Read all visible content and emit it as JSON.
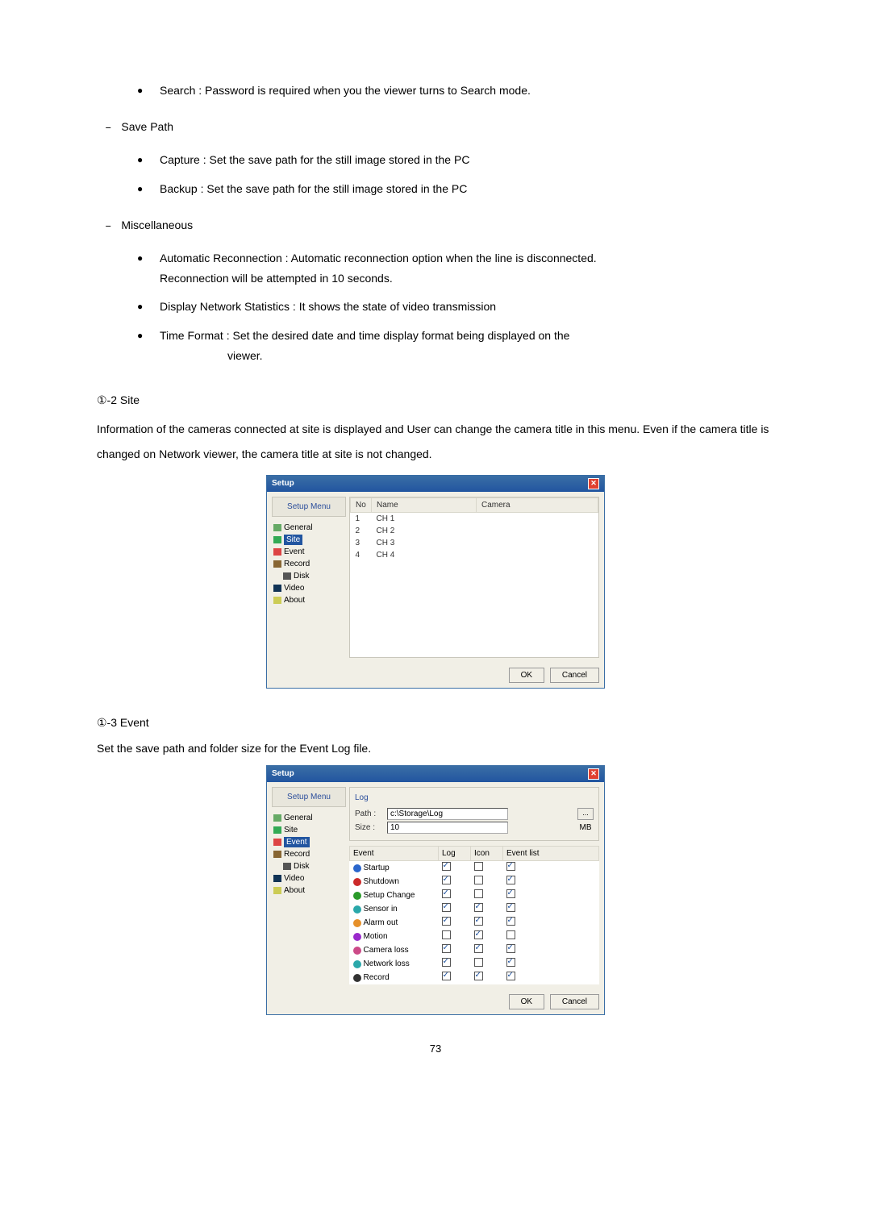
{
  "intro": {
    "search": "Search : Password is required when you the viewer turns to Search mode."
  },
  "savepath": {
    "heading": "Save Path",
    "capture": "Capture : Set the save path for the still image stored in the PC",
    "backup": "Backup : Set the save path for the still image stored in the PC"
  },
  "misc": {
    "heading": "Miscellaneous",
    "auto1": "Automatic Reconnection : Automatic reconnection option when the line is disconnected.",
    "auto2": "Reconnection will be attempted in 10 seconds.",
    "display": "Display Network Statistics : It shows the state of video transmission",
    "time1": "Time Format : Set the desired date and time display format being displayed on the",
    "time2": "viewer."
  },
  "site": {
    "heading": "①-2 Site",
    "para": "Information of the cameras connected at site is displayed and User can change the camera title in this menu. Even if the camera title is changed on Network viewer, the camera title at site is not changed."
  },
  "event": {
    "heading": "①-3 Event",
    "para": "Set the save path and folder size for the Event Log file."
  },
  "dialog": {
    "title": "Setup",
    "menutitle": "Setup Menu",
    "items": {
      "general": "General",
      "site": "Site",
      "event": "Event",
      "record": "Record",
      "disk": "Disk",
      "video": "Video",
      "about": "About"
    },
    "buttons": {
      "ok": "OK",
      "cancel": "Cancel"
    },
    "siteTable": {
      "headers": {
        "no": "No",
        "name": "Name",
        "camera": "Camera"
      },
      "rows": [
        {
          "no": "1",
          "name": "CH 1"
        },
        {
          "no": "2",
          "name": "CH 2"
        },
        {
          "no": "3",
          "name": "CH 3"
        },
        {
          "no": "4",
          "name": "CH 4"
        }
      ]
    }
  },
  "dialog2": {
    "title": "Setup",
    "log": {
      "label": "Log",
      "pathlabel": "Path :",
      "path": "c:\\Storage\\Log",
      "sizelabel": "Size :",
      "size": "10",
      "mb": "MB"
    },
    "eventTable": {
      "headers": {
        "event": "Event",
        "log": "Log",
        "icon": "Icon",
        "eventlist": "Event list"
      },
      "rows": [
        {
          "name": "Startup",
          "log": true,
          "icon": false,
          "list": true,
          "c": "ic-blue"
        },
        {
          "name": "Shutdown",
          "log": true,
          "icon": false,
          "list": true,
          "c": "ic-red"
        },
        {
          "name": "Setup Change",
          "log": true,
          "icon": false,
          "list": true,
          "c": "ic-grn"
        },
        {
          "name": "Sensor in",
          "log": true,
          "icon": true,
          "list": true,
          "c": "ic-cy"
        },
        {
          "name": "Alarm out",
          "log": true,
          "icon": true,
          "list": true,
          "c": "ic-org"
        },
        {
          "name": "Motion",
          "log": false,
          "icon": true,
          "list": false,
          "c": "ic-prp"
        },
        {
          "name": "Camera loss",
          "log": true,
          "icon": true,
          "list": true,
          "c": "ic-pnk"
        },
        {
          "name": "Network loss",
          "log": true,
          "icon": false,
          "list": true,
          "c": "ic-cy"
        },
        {
          "name": "Record",
          "log": true,
          "icon": true,
          "list": true,
          "c": "ic-blk"
        }
      ]
    }
  },
  "pagenum": "73"
}
